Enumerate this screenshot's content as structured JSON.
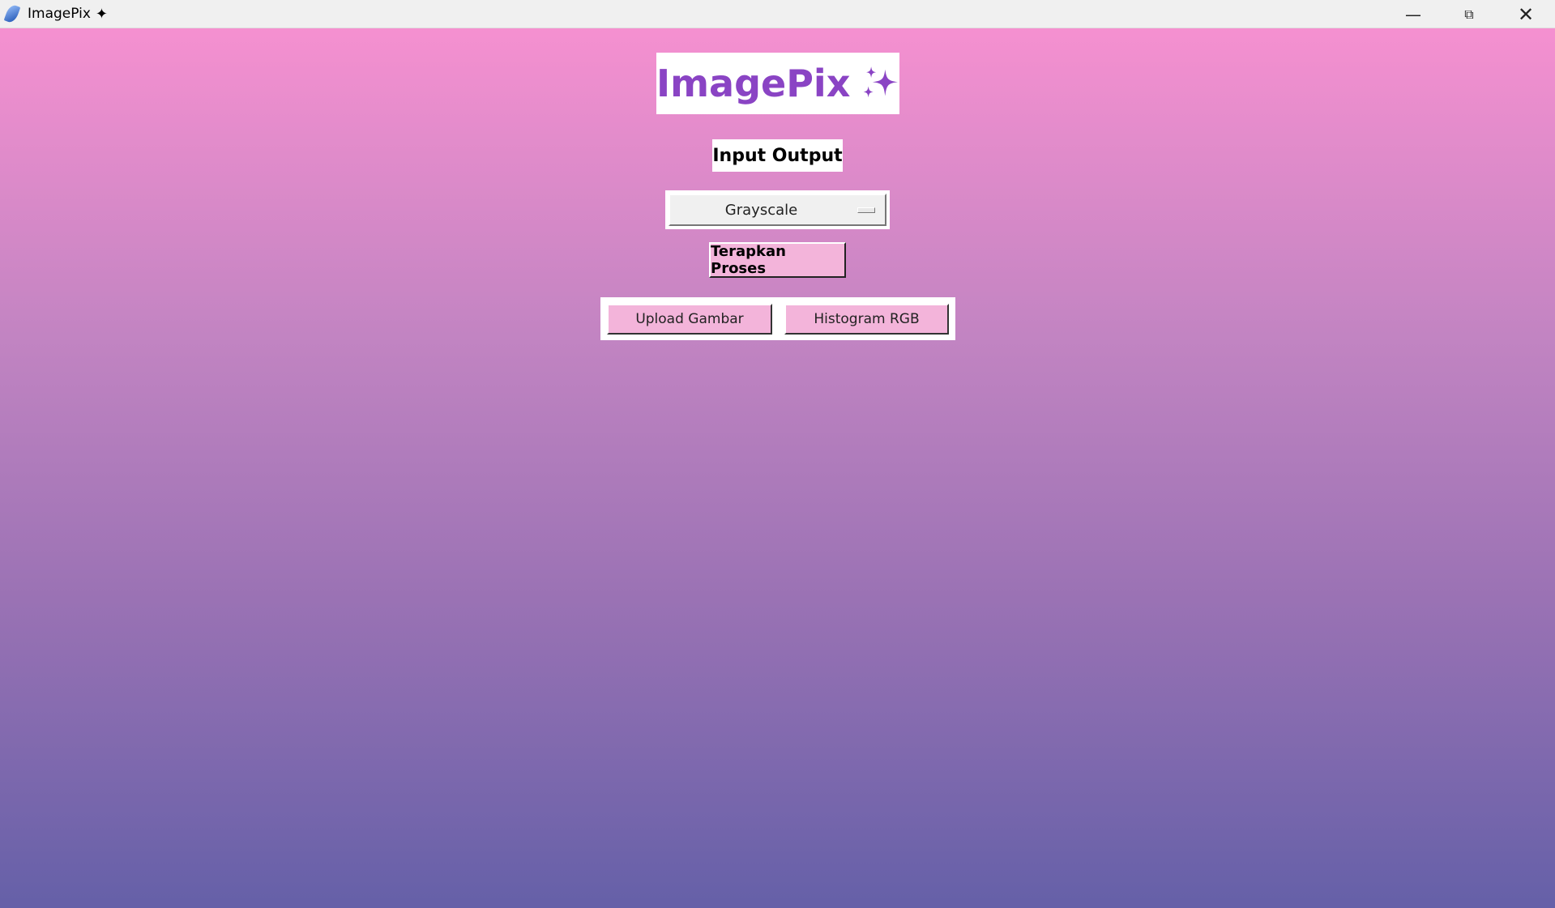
{
  "window": {
    "title": "ImagePix",
    "title_icon": "sparkles-icon",
    "controls": [
      "minimize",
      "restore",
      "close"
    ]
  },
  "logo": {
    "text": "ImagePix",
    "icon": "sparkles-icon",
    "color": "#8a44c4"
  },
  "section_label": "Input Output",
  "dropdown": {
    "selected": "Grayscale"
  },
  "apply_button": "Terapkan Proses",
  "buttons": {
    "upload": "Upload Gambar",
    "histogram": "Histogram RGB"
  }
}
